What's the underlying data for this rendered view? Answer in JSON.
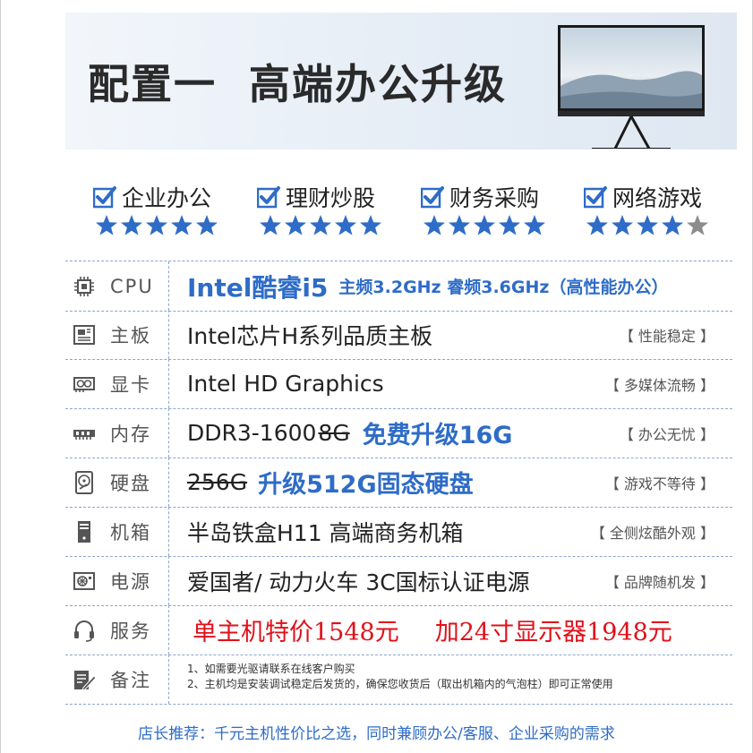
{
  "banner": {
    "title_a": "配置一",
    "title_b": "高端办公升级"
  },
  "features": [
    {
      "label": "企业办公",
      "stars": 5
    },
    {
      "label": "理财炒股",
      "stars": 5
    },
    {
      "label": "财务采购",
      "stars": 5
    },
    {
      "label": "网络游戏",
      "stars": 4
    }
  ],
  "colors": {
    "accent": "#2e6cc7",
    "price": "#e0101a",
    "star_off": "#8c8c8c"
  },
  "specs": {
    "cpu": {
      "label": "CPU",
      "icon": "cpu-icon",
      "brand": "Intel酷睿i5",
      "detail": "主频3.2GHz 睿频3.6GHz（高性能办公）"
    },
    "board": {
      "label": "主板",
      "icon": "motherboard-icon",
      "value": "Intel芯片H系列品质主板",
      "note": "【 性能稳定 】"
    },
    "gpu": {
      "label": "显卡",
      "icon": "graphics-card-icon",
      "value": "Intel HD Graphics",
      "note": "【 多媒体流畅 】"
    },
    "ram": {
      "label": "内存",
      "icon": "memory-icon",
      "value": "DDR3-1600",
      "old": "8G",
      "upgrade": "免费升级16G",
      "note": "【 办公无忧 】"
    },
    "disk": {
      "label": "硬盘",
      "icon": "hard-disk-icon",
      "old": "256G",
      "upgrade": "升级512G固态硬盘",
      "note": "【 游戏不等待 】"
    },
    "case": {
      "label": "机箱",
      "icon": "computer-case-icon",
      "value": "半岛铁盒H11 高端商务机箱",
      "note": "【 全侧炫酷外观 】"
    },
    "psu": {
      "label": "电源",
      "icon": "power-supply-icon",
      "value": "爱国者/ 动力火车 3C国标认证电源",
      "note": "【 品牌随机发 】"
    },
    "service": {
      "label": "服务",
      "icon": "headset-icon",
      "price1": "单主机特价1548元",
      "price2": "加24寸显示器1948元"
    },
    "remark": {
      "label": "备注",
      "icon": "edit-note-icon",
      "line1": "1、如需要光驱请联系在线客户购买",
      "line2": "2、主机均是安装调试稳定后发货的，确保您收货后（取出机箱内的气泡柱）即可正常使用"
    }
  },
  "footer": "店长推荐：千元主机性价比之选，同时兼顾办公/客服、企业采购的需求"
}
